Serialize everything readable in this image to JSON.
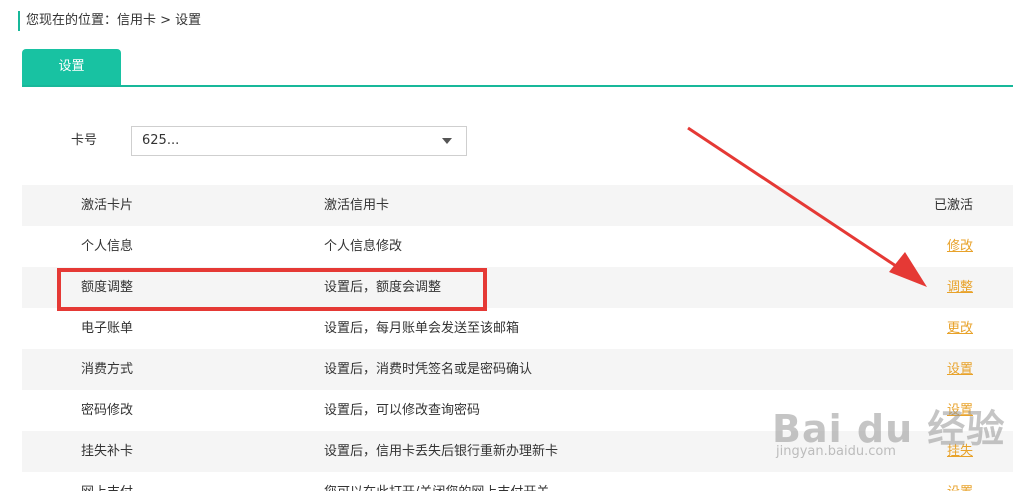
{
  "breadcrumb": "您现在的位置：信用卡 > 设置",
  "tab": {
    "label": "设置"
  },
  "card": {
    "label": "卡号",
    "value": "625..."
  },
  "table": {
    "header": [
      "激活卡片",
      "激活信用卡",
      "已激活"
    ],
    "rows": [
      {
        "name": "个人信息",
        "desc": "个人信息修改",
        "action": "修改"
      },
      {
        "name": "额度调整",
        "desc": "设置后，额度会调整",
        "action": "调整"
      },
      {
        "name": "电子账单",
        "desc": "设置后，每月账单会发送至该邮箱",
        "action": "更改"
      },
      {
        "name": "消费方式",
        "desc": "设置后，消费时凭签名或是密码确认",
        "action": "设置"
      },
      {
        "name": "密码修改",
        "desc": "设置后，可以修改查询密码",
        "action": "设置"
      },
      {
        "name": "挂失补卡",
        "desc": "设置后，信用卡丢失后银行重新办理新卡",
        "action": "挂失"
      },
      {
        "name": "网上支付",
        "desc": "您可以在此打开/关闭您的网上支付开关",
        "action": "设置"
      }
    ]
  },
  "colors": {
    "accent": "#18c2a2",
    "link": "#e8a22a",
    "annotation": "#e53935"
  },
  "watermark": {
    "brand": "Bai du 经验",
    "url": "jingyan.baidu.com"
  }
}
